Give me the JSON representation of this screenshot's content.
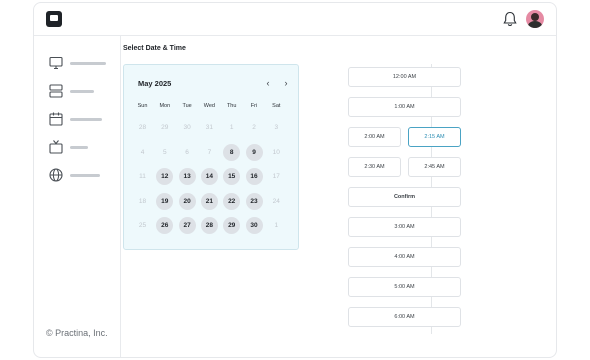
{
  "sidebar": {
    "icons": [
      "monitor-icon",
      "layers-icon",
      "calendar-icon",
      "tv-icon",
      "globe-icon"
    ],
    "footer": "© Practina, Inc."
  },
  "main": {
    "section_title": "Select Date & Time"
  },
  "calendar": {
    "month_label": "May 2025",
    "weekdays": [
      "Sun",
      "Mon",
      "Tue",
      "Wed",
      "Thu",
      "Fri",
      "Sat"
    ],
    "weeks": [
      [
        {
          "d": "28",
          "available": false
        },
        {
          "d": "29",
          "available": false
        },
        {
          "d": "30",
          "available": false
        },
        {
          "d": "31",
          "available": false
        },
        {
          "d": "1",
          "available": false
        },
        {
          "d": "2",
          "available": false
        },
        {
          "d": "3",
          "available": false
        }
      ],
      [
        {
          "d": "4",
          "available": false
        },
        {
          "d": "5",
          "available": false
        },
        {
          "d": "6",
          "available": false
        },
        {
          "d": "7",
          "available": false
        },
        {
          "d": "8",
          "available": true
        },
        {
          "d": "9",
          "available": true
        },
        {
          "d": "10",
          "available": false
        }
      ],
      [
        {
          "d": "11",
          "available": false
        },
        {
          "d": "12",
          "available": true
        },
        {
          "d": "13",
          "available": true
        },
        {
          "d": "14",
          "available": true
        },
        {
          "d": "15",
          "available": true
        },
        {
          "d": "16",
          "available": true
        },
        {
          "d": "17",
          "available": false
        }
      ],
      [
        {
          "d": "18",
          "available": false
        },
        {
          "d": "19",
          "available": true
        },
        {
          "d": "20",
          "available": true
        },
        {
          "d": "21",
          "available": true
        },
        {
          "d": "22",
          "available": true
        },
        {
          "d": "23",
          "available": true
        },
        {
          "d": "24",
          "available": false
        }
      ],
      [
        {
          "d": "25",
          "available": false
        },
        {
          "d": "26",
          "available": true
        },
        {
          "d": "27",
          "available": true
        },
        {
          "d": "28",
          "available": true
        },
        {
          "d": "29",
          "available": true
        },
        {
          "d": "30",
          "available": true
        },
        {
          "d": "1",
          "available": false
        }
      ]
    ]
  },
  "time_slots": {
    "full": [
      "12:00 AM",
      "1:00 AM"
    ],
    "split_row1": [
      "2:00 AM",
      "2:15 AM"
    ],
    "split_row2": [
      "2:30 AM",
      "2:45 AM"
    ],
    "selected": "2:15 AM",
    "confirm_label": "Confirm",
    "after": [
      "3:00 AM",
      "4:00 AM",
      "5:00 AM",
      "6:00 AM"
    ]
  },
  "colors": {
    "calendar_bg": "#eef9fc",
    "selected_accent": "#4aa3c4"
  }
}
